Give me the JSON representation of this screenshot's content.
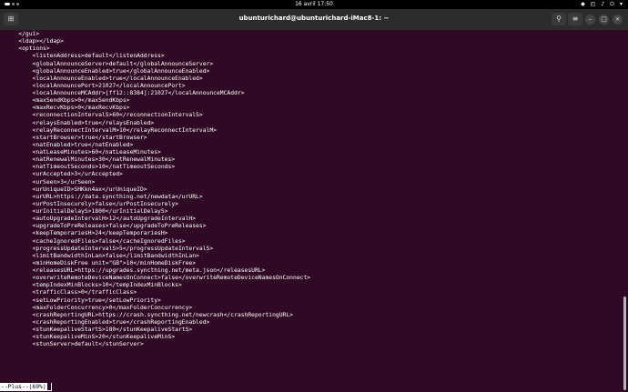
{
  "topbar": {
    "clock": "16 avril  17:50",
    "tray_icons": [
      "shield-icon",
      "network-icon",
      "volume-icon",
      "power-icon",
      "menu-chevron-icon"
    ]
  },
  "titlebar": {
    "title": "ubunturichard@ubunturichard-iMac8-1: ~",
    "new_tab_icon": "new-tab-icon",
    "search_icon": "search-icon",
    "menu_icon": "hamburger-icon",
    "window_buttons": [
      "minimize-icon",
      "maximize-icon",
      "close-icon"
    ]
  },
  "terminal": {
    "lines": [
      "    </gui>",
      "    <ldap></ldap>",
      "    <options>",
      "        <listenAddress>default</listenAddress>",
      "        <globalAnnounceServer>default</globalAnnounceServer>",
      "        <globalAnnounceEnabled>true</globalAnnounceEnabled>",
      "        <localAnnounceEnabled>true</localAnnounceEnabled>",
      "        <localAnnouncePort>21027</localAnnouncePort>",
      "        <localAnnounceMCAddr>[ff12::8384]:21027</localAnnounceMCAddr>",
      "        <maxSendKbps>0</maxSendKbps>",
      "        <maxRecvKbps>0</maxRecvKbps>",
      "        <reconnectionIntervalS>60</reconnectionIntervalS>",
      "        <relaysEnabled>true</relaysEnabled>",
      "        <relayReconnectIntervalM>10</relayReconnectIntervalM>",
      "        <startBrowser>true</startBrowser>",
      "        <natEnabled>true</natEnabled>",
      "        <natLeaseMinutes>60</natLeaseMinutes>",
      "        <natRenewalMinutes>30</natRenewalMinutes>",
      "        <natTimeoutSeconds>10</natTimeoutSeconds>",
      "        <urAccepted>3</urAccepted>",
      "        <urSeen>3</urSeen>",
      "        <urUniqueID>SHKkn4ax</urUniqueID>",
      "        <urURL>https://data.syncthing.net/newdata</urURL>",
      "        <urPostInsecurely>false</urPostInsecurely>",
      "        <urInitialDelayS>1800</urInitialDelayS>",
      "        <autoUpgradeIntervalH>12</autoUpgradeIntervalH>",
      "        <upgradeToPreReleases>false</upgradeToPreReleases>",
      "        <keepTemporariesH>24</keepTemporariesH>",
      "        <cacheIgnoredFiles>false</cacheIgnoredFiles>",
      "        <progressUpdateIntervalS>5</progressUpdateIntervalS>",
      "        <limitBandwidthInLan>false</limitBandwidthInLan>",
      "        <minHomeDiskFree unit=\"GB\">10</minHomeDiskFree>",
      "        <releasesURL>https://upgrades.syncthing.net/meta.json</releasesURL>",
      "        <overwriteRemoteDeviceNamesOnConnect>false</overwriteRemoteDeviceNamesOnConnect>",
      "        <tempIndexMinBlocks>10</tempIndexMinBlocks>",
      "        <trafficClass>0</trafficClass>",
      "        <setLowPriority>true</setLowPriority>",
      "        <maxFolderConcurrency>0</maxFolderConcurrency>",
      "        <crashReportingURL>https://crash.syncthing.net/newcrash</crashReportingURL>",
      "        <crashReportingEnabled>true</crashReportingEnabled>",
      "        <stunKeepaliveStartS>180</stunKeepaliveStartS>",
      "        <stunKeepaliveMinS>20</stunKeepaliveMinS>",
      "        <stunServer>default</stunServer>"
    ],
    "status_line": "--Plus--(69%)",
    "scroll_position_fraction": 0.74
  },
  "colors": {
    "terminal_background": "#300a24",
    "terminal_text": "#ffffff",
    "titlebar_background": "#2c2c2c",
    "topbar_background": "#000000"
  }
}
